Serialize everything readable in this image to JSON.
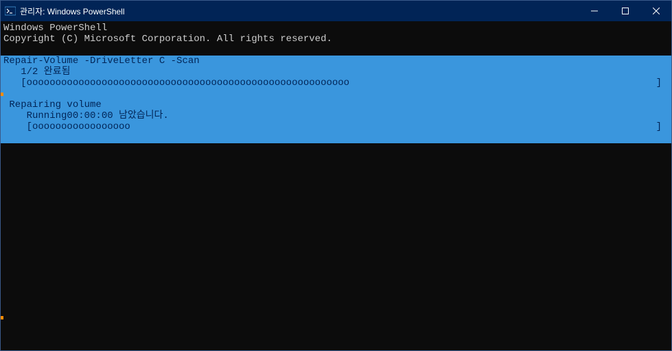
{
  "titlebar": {
    "title": "관리자: Windows PowerShell"
  },
  "header": {
    "line1": "Windows PowerShell",
    "line2": "Copyright (C) Microsoft Corporation. All rights reserved."
  },
  "progress": {
    "activity": "Repair-Volume -DriveLetter C -Scan",
    "status1": "   1/2 완료됨",
    "bar1_left": "   [oooooooooooooooooooooooooooooooooooooooooooooooooooooooo",
    "bar1_right": "]",
    "time": "   00:00:00 남았습니다.",
    "sub_activity": " Repairing volume",
    "sub_status": "    Running",
    "bar2_left": "    [ooooooooooooooooo",
    "bar2_right": "]"
  }
}
